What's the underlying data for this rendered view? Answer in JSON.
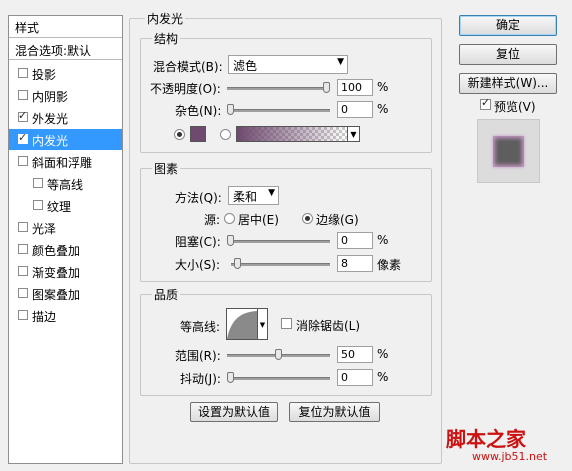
{
  "left_panel": {
    "header": "样式",
    "blend_options": "混合选项:默认",
    "items": [
      {
        "label": "投影",
        "checked": false
      },
      {
        "label": "内阴影",
        "checked": false
      },
      {
        "label": "外发光",
        "checked": true
      },
      {
        "label": "内发光",
        "checked": true,
        "selected": true
      },
      {
        "label": "斜面和浮雕",
        "checked": false
      },
      {
        "label": "等高线",
        "checked": false
      },
      {
        "label": "纹理",
        "checked": false
      },
      {
        "label": "光泽",
        "checked": false
      },
      {
        "label": "颜色叠加",
        "checked": false
      },
      {
        "label": "渐变叠加",
        "checked": false
      },
      {
        "label": "图案叠加",
        "checked": false
      },
      {
        "label": "描边",
        "checked": false
      }
    ]
  },
  "panel_title": "内发光",
  "structure": {
    "title": "结构",
    "blend_mode_label": "混合模式(B):",
    "blend_mode_value": "滤色",
    "opacity_label": "不透明度(O):",
    "opacity_value": "100",
    "opacity_fraction": 1.0,
    "noise_label": "杂色(N):",
    "noise_value": "0",
    "noise_fraction": 0,
    "percent": "%",
    "color_swatch": "#6e4a6e"
  },
  "elements": {
    "title": "图素",
    "method_label": "方法(Q):",
    "method_value": "柔和",
    "source_label": "源:",
    "source_center": "居中(E)",
    "source_edge": "边缘(G)",
    "choke_label": "阻塞(C):",
    "choke_value": "0",
    "choke_fraction": 0,
    "size_label": "大小(S):",
    "size_value": "8",
    "size_fraction": 0.032,
    "size_unit": "像素",
    "percent": "%"
  },
  "quality": {
    "title": "品质",
    "contour_label": "等高线:",
    "antialias_label": "消除锯齿(L)",
    "range_label": "范围(R):",
    "range_value": "50",
    "range_fraction": 0.5,
    "jitter_label": "抖动(J):",
    "jitter_value": "0",
    "jitter_fraction": 0,
    "percent": "%"
  },
  "bottom_buttons": {
    "set_default": "设置为默认值",
    "reset_default": "复位为默认值"
  },
  "right_buttons": {
    "ok": "确定",
    "reset": "复位",
    "new_style": "新建样式(W)...",
    "preview": "预览(V)"
  },
  "watermark": {
    "line1": "脚本之家",
    "line2": "www.jb51.net"
  }
}
